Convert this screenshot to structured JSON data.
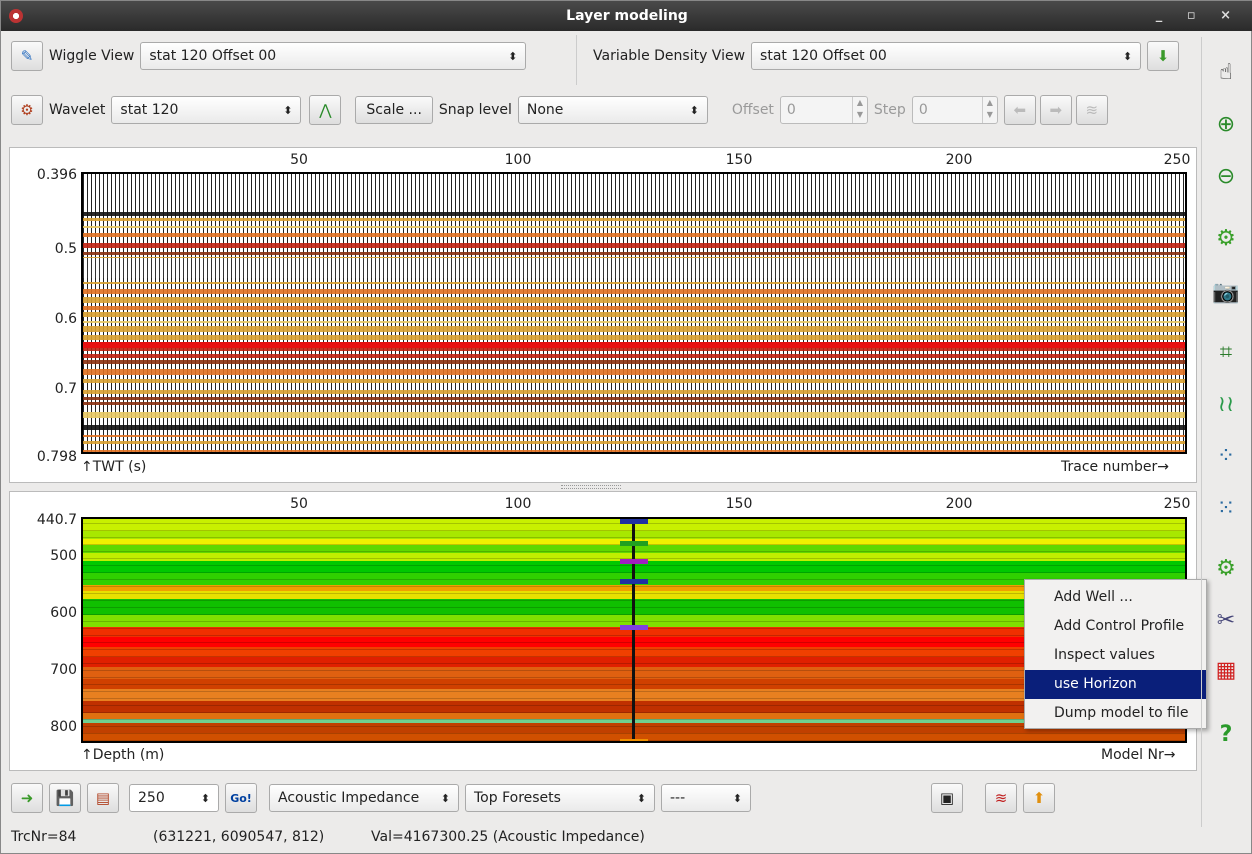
{
  "window": {
    "title": "Layer modeling",
    "controls": "_ ▫ ×"
  },
  "toolbar1": {
    "wiggle_label": "Wiggle View",
    "wiggle_value": "stat 120 Offset 00",
    "vd_label": "Variable Density View",
    "vd_value": "stat 120 Offset 00"
  },
  "toolbar2": {
    "wavelet_label": "Wavelet",
    "wavelet_value": "stat 120",
    "scale_label": "Scale ...",
    "snap_label": "Snap level",
    "snap_value": "None",
    "offset_label": "Offset",
    "offset_value": "0",
    "step_label": "Step",
    "step_value": "0"
  },
  "seismic": {
    "top_ticks": [
      "50",
      "100",
      "150",
      "200",
      "250"
    ],
    "left_ticks": [
      "0.396",
      "0.5",
      "0.6",
      "0.7",
      "0.798"
    ],
    "ylabel": "TWT (s)",
    "xlabel": "Trace number"
  },
  "model": {
    "top_ticks": [
      "50",
      "100",
      "150",
      "200",
      "250"
    ],
    "left_ticks": [
      "440.7",
      "500",
      "600",
      "700",
      "800"
    ],
    "ylabel": "Depth (m)",
    "xlabel": "Model Nr"
  },
  "context_menu": {
    "items": [
      "Add Well ...",
      "Add Control Profile",
      "Inspect values",
      "use Horizon",
      "Dump model to file"
    ],
    "selected": "use Horizon"
  },
  "bottom": {
    "nr_models": "250",
    "go_label": "Go!",
    "property": "Acoustic Impedance",
    "horizon": "Top Foresets",
    "extra": "---"
  },
  "status": {
    "trc": "TrcNr=84",
    "coords": "(631221, 6090547, 812)",
    "value": "Val=4167300.25 (Acoustic Impedance)"
  },
  "right_tools": [
    "hand-icon",
    "zoom-in-icon",
    "zoom-out-icon",
    "settings-gear-icon",
    "camera-icon",
    "chart-icon",
    "wiggle-icon",
    "scatter-icon",
    "scatter-alt-icon",
    "gear-icon",
    "tools-icon",
    "layers-icon",
    "help-icon"
  ],
  "colors": {
    "selection": "#0a1f7a",
    "titlebar": "#333333"
  }
}
